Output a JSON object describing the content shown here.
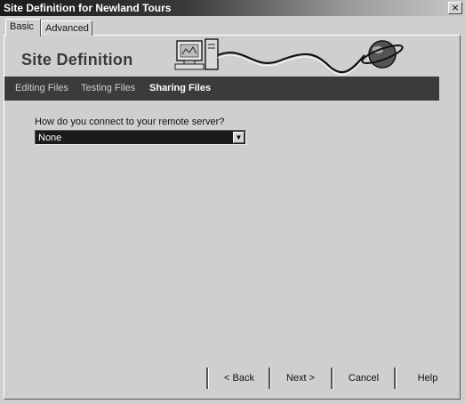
{
  "window": {
    "title": "Site Definition for Newland Tours",
    "close_glyph": "×"
  },
  "tabs": [
    {
      "label": "Basic",
      "active": true
    },
    {
      "label": "Advanced",
      "active": false
    }
  ],
  "banner": {
    "heading": "Site Definition",
    "icon": "computer-to-globe-graphic"
  },
  "nav": {
    "items": [
      {
        "label": "Editing Files"
      },
      {
        "label": "Testing Files"
      },
      {
        "label": "Sharing Files",
        "active": true
      }
    ]
  },
  "form": {
    "question": "How do you connect to your remote server?",
    "select_value": "None"
  },
  "buttons": {
    "back": "< Back",
    "next": "Next >",
    "cancel": "Cancel",
    "help": "Help"
  },
  "colors": {
    "nav_background": "#3b3b3b",
    "select_background": "#1a1a1a"
  }
}
